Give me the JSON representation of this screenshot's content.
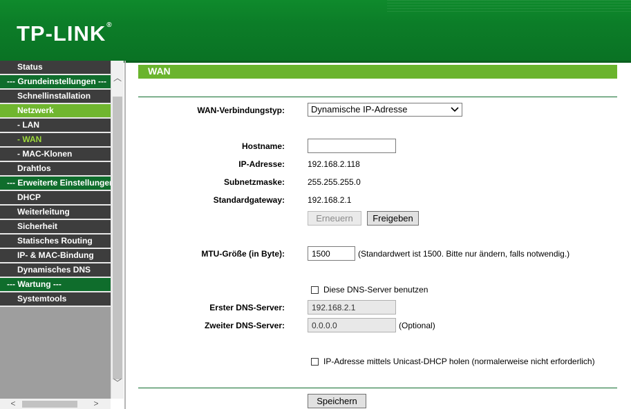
{
  "brand": {
    "logo": "TP-LINK",
    "registered": "®"
  },
  "sidebar": {
    "items": [
      {
        "label": "Status",
        "kind": "item"
      },
      {
        "label": "--- Grundeinstellungen ---",
        "kind": "group"
      },
      {
        "label": "Schnellinstallation",
        "kind": "item"
      },
      {
        "label": "Netzwerk",
        "kind": "active"
      },
      {
        "label": "- LAN",
        "kind": "sub"
      },
      {
        "label": "- WAN",
        "kind": "sub-current"
      },
      {
        "label": "- MAC-Klonen",
        "kind": "sub"
      },
      {
        "label": "Drahtlos",
        "kind": "item"
      },
      {
        "label": "--- Erweiterte Einstellungen ---",
        "kind": "group"
      },
      {
        "label": "DHCP",
        "kind": "item"
      },
      {
        "label": "Weiterleitung",
        "kind": "item"
      },
      {
        "label": "Sicherheit",
        "kind": "item"
      },
      {
        "label": "Statisches Routing",
        "kind": "item"
      },
      {
        "label": "IP- & MAC-Bindung",
        "kind": "item"
      },
      {
        "label": "Dynamisches DNS",
        "kind": "item"
      },
      {
        "label": "--- Wartung ---",
        "kind": "group"
      },
      {
        "label": "Systemtools",
        "kind": "item"
      }
    ]
  },
  "main": {
    "title": "WAN",
    "connection_type_label": "WAN-Verbindungstyp:",
    "connection_type_value": "Dynamische IP-Adresse",
    "hostname_label": "Hostname:",
    "hostname_value": "",
    "ip_label": "IP-Adresse:",
    "ip_value": "192.168.2.118",
    "subnet_label": "Subnetzmaske:",
    "subnet_value": "255.255.255.0",
    "gateway_label": "Standardgateway:",
    "gateway_value": "192.168.2.1",
    "renew_button": "Erneuern",
    "release_button": "Freigeben",
    "mtu_label": "MTU-Größe (in Byte):",
    "mtu_value": "1500",
    "mtu_hint": "(Standardwert ist 1500. Bitte nur ändern, falls notwendig.)",
    "use_dns_label": "Diese DNS-Server benutzen",
    "use_dns_checked": false,
    "dns1_label": "Erster DNS-Server:",
    "dns1_value": "192.168.2.1",
    "dns2_label": "Zweiter DNS-Server:",
    "dns2_value": "0.0.0.0",
    "dns2_hint": "(Optional)",
    "unicast_label": "IP-Adresse mittels Unicast-DHCP holen (normalerweise nicht erforderlich)",
    "unicast_checked": false,
    "save_button": "Speichern"
  },
  "colors": {
    "banner": "#0c7d28",
    "group_bg": "#0f6d2c",
    "active_bg": "#70b62f",
    "title_bar": "#6ab42d"
  }
}
